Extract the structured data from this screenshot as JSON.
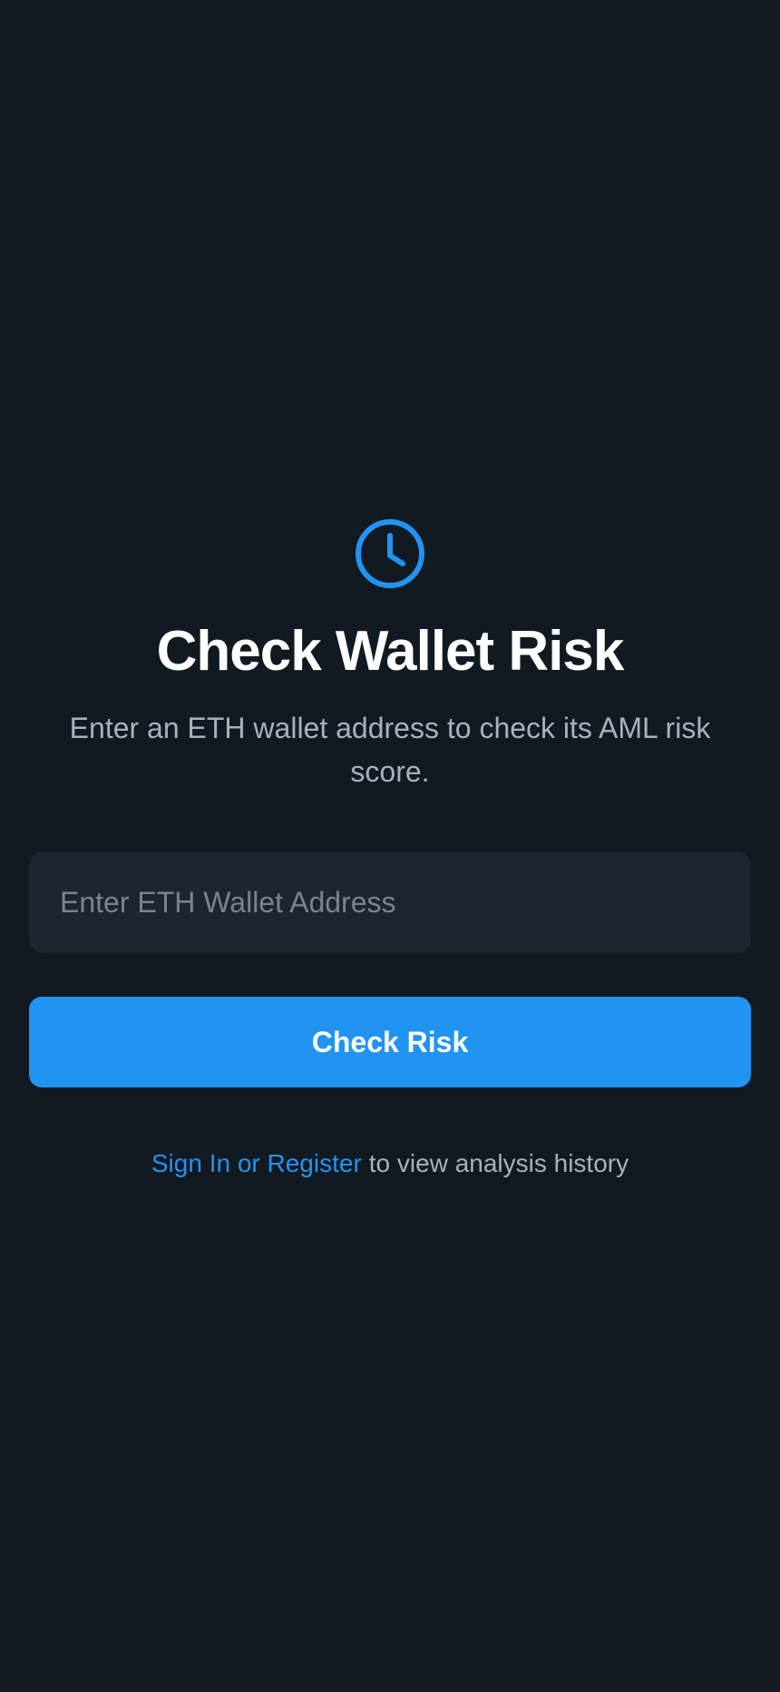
{
  "colors": {
    "background": "#111921",
    "accent": "#2194f2",
    "input_background": "#1d262e",
    "subtitle_text": "#a9b1bb"
  },
  "header": {
    "icon": "clock-icon",
    "title": "Check Wallet Risk",
    "subtitle": "Enter an ETH wallet address to check its AML risk score."
  },
  "form": {
    "address_value": "",
    "address_placeholder": "Enter ETH Wallet Address",
    "submit_label": "Check Risk"
  },
  "footer": {
    "signin_link": "Sign In or Register",
    "suffix_text": "to view analysis history"
  }
}
